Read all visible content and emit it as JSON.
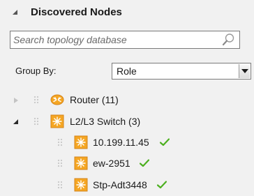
{
  "panel": {
    "title": "Discovered Nodes",
    "collapse_icon": "collapse-triangle-icon"
  },
  "search": {
    "placeholder": "Search topology database",
    "value": "",
    "icon": "search-icon"
  },
  "group_by": {
    "label": "Group By:",
    "selected": "Role"
  },
  "tree": {
    "groups": [
      {
        "label": "Router (11)",
        "expanded": false,
        "icon": "router-icon",
        "icon_color": "#f5a623"
      },
      {
        "label": "L2/L3 Switch (3)",
        "expanded": true,
        "icon": "switch-icon",
        "icon_color": "#f5a623",
        "children": [
          {
            "label": "10.199.11.45",
            "icon": "switch-icon",
            "status": "check-icon"
          },
          {
            "label": "ew-2951",
            "icon": "switch-icon",
            "status": "check-icon"
          },
          {
            "label": "Stp-Adt3448",
            "icon": "switch-icon",
            "status": "check-icon"
          }
        ]
      }
    ]
  },
  "colors": {
    "background": "#f1f1f1",
    "icon_orange": "#f5a623",
    "check_green": "#4caf1f"
  }
}
